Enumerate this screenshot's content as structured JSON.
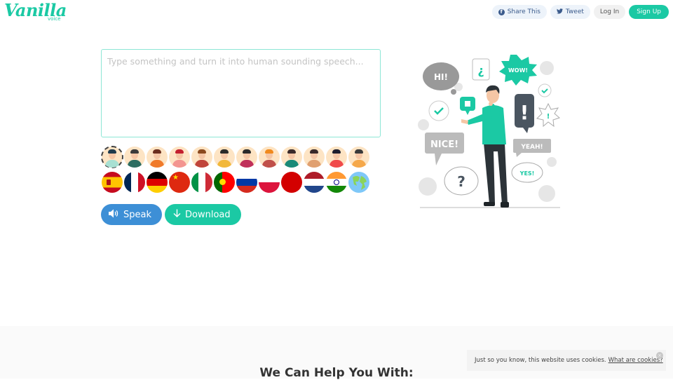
{
  "header": {
    "logo_text": "Vanilla",
    "logo_subtext": "voice",
    "nav": {
      "share_label": "Share This",
      "tweet_label": "Tweet",
      "login_label": "Log In",
      "signup_label": "Sign Up"
    }
  },
  "editor": {
    "value": "",
    "placeholder": "Type something and turn it into human sounding speech..."
  },
  "voices": [
    {
      "name": "voice-1",
      "selected": true,
      "hair": "#1e3a4c",
      "shirt": "#a8e0d2"
    },
    {
      "name": "voice-2",
      "selected": false,
      "hair": "#3b3b3b",
      "shirt": "#2e6e62"
    },
    {
      "name": "voice-3",
      "selected": false,
      "hair": "#6b2e1e",
      "shirt": "#f07a2a"
    },
    {
      "name": "voice-4",
      "selected": false,
      "hair": "#c3202f",
      "shirt": "#f39590"
    },
    {
      "name": "voice-5",
      "selected": false,
      "hair": "#8b4a1e",
      "shirt": "#c0443a"
    },
    {
      "name": "voice-6",
      "selected": false,
      "hair": "#2a2a2a",
      "shirt": "#f2b83a"
    },
    {
      "name": "voice-7",
      "selected": false,
      "hair": "#2a2a2a",
      "shirt": "#c0305a"
    },
    {
      "name": "voice-8",
      "selected": false,
      "hair": "#f08a1e",
      "shirt": "#c0504a"
    },
    {
      "name": "voice-9",
      "selected": false,
      "hair": "#3a2a2a",
      "shirt": "#1a8a78"
    },
    {
      "name": "voice-10",
      "selected": false,
      "hair": "#3a2a2a",
      "shirt": "#e0a070"
    },
    {
      "name": "voice-11",
      "selected": false,
      "hair": "#1e1e2e",
      "shirt": "#f04a4a"
    },
    {
      "name": "voice-12",
      "selected": false,
      "hair": "#3a3a3a",
      "shirt": "#f5a84a"
    }
  ],
  "languages": [
    {
      "name": "spanish",
      "colors": [
        "#c60b1e",
        "#ffc400",
        "#c60b1e"
      ],
      "style": "h3w"
    },
    {
      "name": "french",
      "colors": [
        "#002654",
        "#ffffff",
        "#ce1126"
      ],
      "style": "v3"
    },
    {
      "name": "german",
      "colors": [
        "#000000",
        "#dd0000",
        "#ffce00"
      ],
      "style": "h3"
    },
    {
      "name": "chinese",
      "colors": [
        "#de2910",
        "#ffde00"
      ],
      "style": "cn"
    },
    {
      "name": "italian",
      "colors": [
        "#009246",
        "#ffffff",
        "#ce2b37"
      ],
      "style": "v3"
    },
    {
      "name": "portuguese",
      "colors": [
        "#006600",
        "#ff0000"
      ],
      "style": "pt"
    },
    {
      "name": "russian",
      "colors": [
        "#ffffff",
        "#0039a6",
        "#d52b1e"
      ],
      "style": "h3"
    },
    {
      "name": "polish",
      "colors": [
        "#ffffff",
        "#dc143c"
      ],
      "style": "h2"
    },
    {
      "name": "japanese-red",
      "colors": [
        "#d30000"
      ],
      "style": "solid"
    },
    {
      "name": "dutch",
      "colors": [
        "#ae1c28",
        "#ffffff",
        "#21468b"
      ],
      "style": "h3"
    },
    {
      "name": "hindi",
      "colors": [
        "#ff9933",
        "#ffffff",
        "#138808"
      ],
      "style": "in"
    },
    {
      "name": "world",
      "colors": [
        "#7fc8f8",
        "#8bd45a"
      ],
      "style": "globe"
    }
  ],
  "actions": {
    "speak_label": "Speak",
    "download_label": "Download"
  },
  "illustration": {
    "bubbles": [
      "HI!",
      "¿",
      "WOW!",
      "!",
      "NICE!",
      "YEAH!",
      "YES!",
      "?"
    ]
  },
  "section2": {
    "title": "We Can Help You With:"
  },
  "cookie": {
    "text": "Just so you know, this website uses cookies.",
    "link": "What are cookies?",
    "close": "×"
  },
  "colors": {
    "brand": "#1bc9a4",
    "speak": "#3d8fd6"
  }
}
